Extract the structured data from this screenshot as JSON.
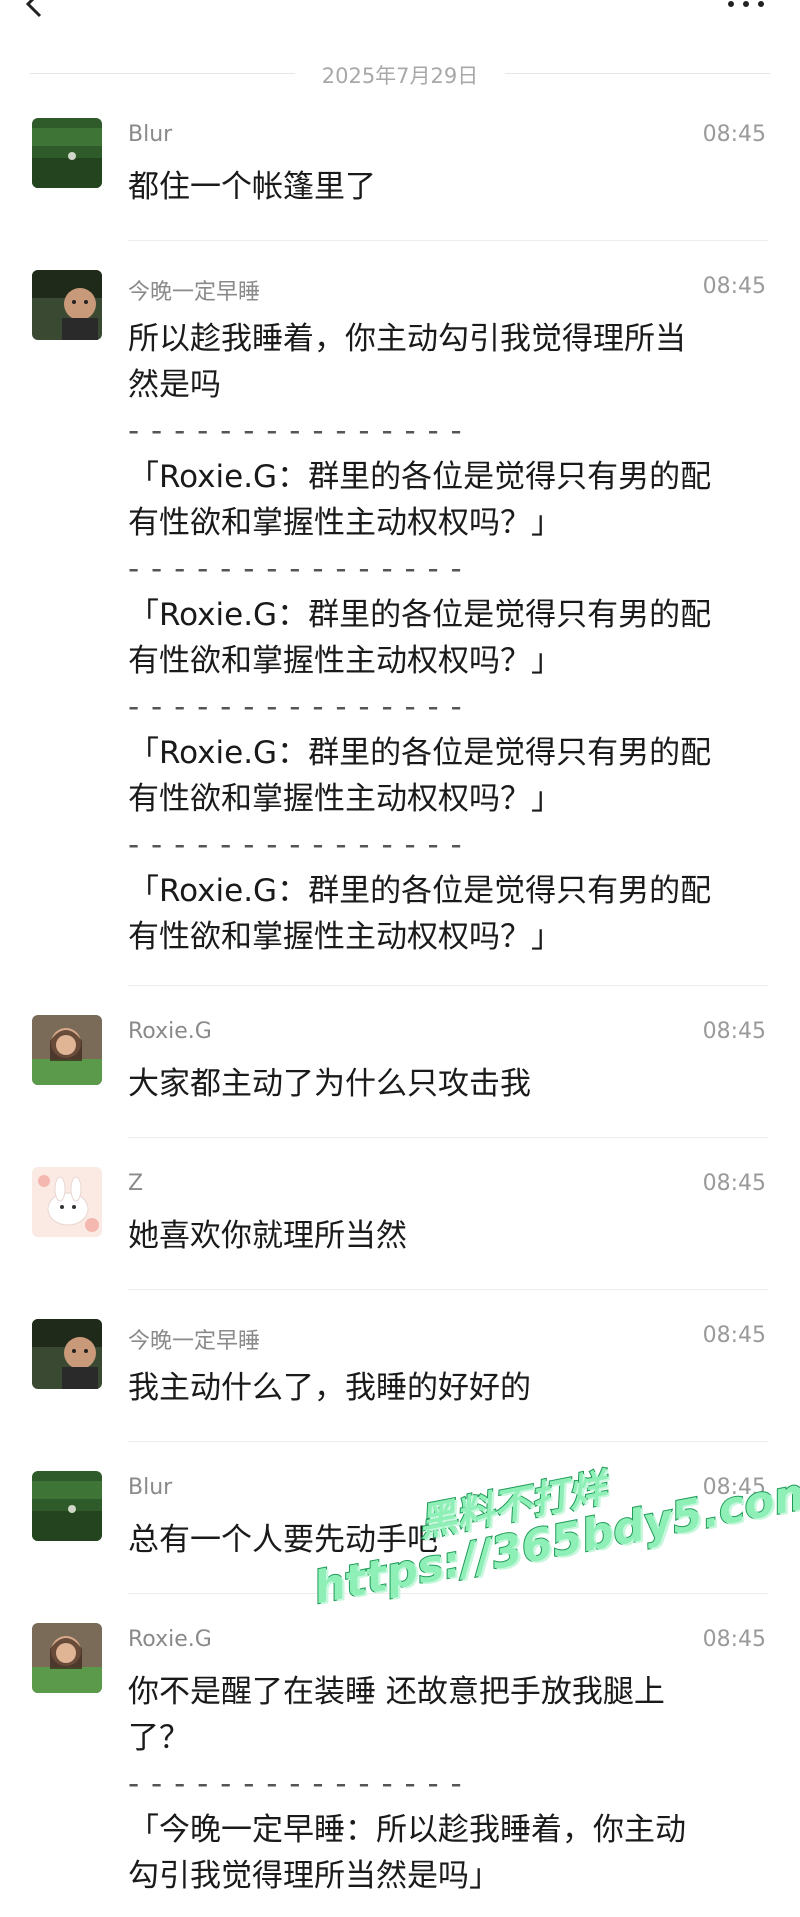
{
  "date_separator": "2025年7月29日",
  "messages": [
    {
      "sender": "Blur",
      "time": "08:45",
      "lines": [
        "都住一个帐篷里了"
      ]
    },
    {
      "sender": "今晚一定早睡",
      "time": "08:45",
      "lines": [
        "所以趁我睡着，你主动勾引我觉得理所当",
        "然是吗"
      ],
      "separator": "- - - - - - - - - - - - - - -",
      "quote_lines": [
        "「Roxie.G：群里的各位是觉得只有男的配",
        "有性欲和掌握性主动权权吗？」"
      ]
    },
    {
      "sender": "Roxie.G",
      "time": "08:45",
      "lines": [
        "大家都主动了为什么只攻击我"
      ]
    },
    {
      "sender": "Z",
      "time": "08:45",
      "lines": [
        "她喜欢你就理所当然"
      ]
    },
    {
      "sender": "今晚一定早睡",
      "time": "08:45",
      "lines": [
        "我主动什么了，我睡的好好的"
      ]
    },
    {
      "sender": "Blur",
      "time": "08:45",
      "lines": [
        "总有一个人要先动手吧"
      ]
    },
    {
      "sender": "Roxie.G",
      "time": "08:45",
      "lines": [
        "你不是醒了在装睡 还故意把手放我腿上",
        "了？"
      ],
      "separator": "- - - - - - - - - - - - - - -",
      "quote_lines": [
        "「今晚一定早睡：所以趁我睡着，你主动",
        "勾引我觉得理所当然是吗」"
      ]
    }
  ],
  "watermark": {
    "line1": "黑料不打烊",
    "line2": "https://365bdy5.com"
  }
}
